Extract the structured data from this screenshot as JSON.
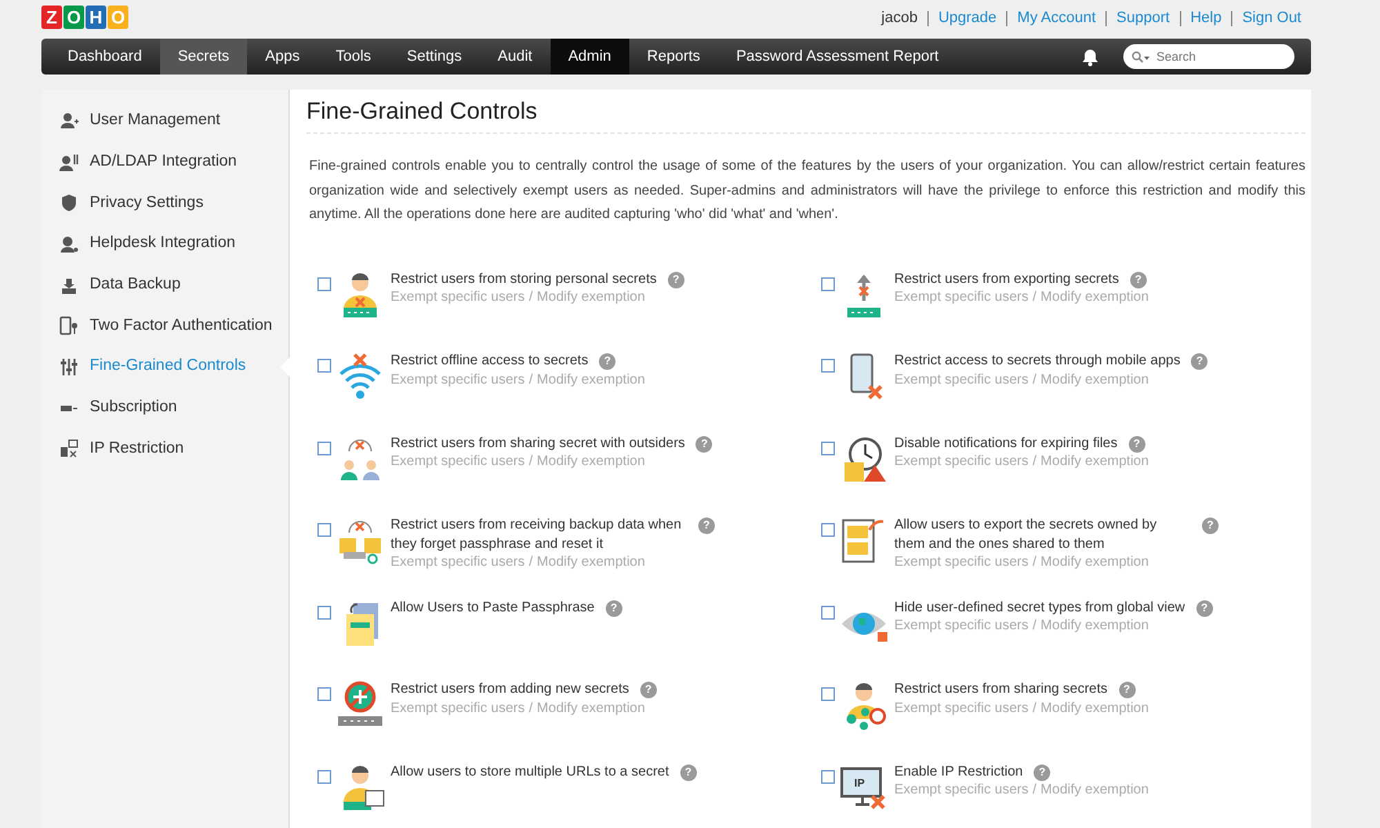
{
  "logo": [
    {
      "letter": "Z",
      "color": "#e42527"
    },
    {
      "letter": "O",
      "color": "#089949"
    },
    {
      "letter": "H",
      "color": "#226db4"
    },
    {
      "letter": "O",
      "color": "#f9b21d"
    }
  ],
  "user": "jacob",
  "header_links": [
    "Upgrade",
    "My Account",
    "Support",
    "Help",
    "Sign Out"
  ],
  "nav": [
    {
      "label": "Dashboard",
      "selected": false,
      "highlighted": false
    },
    {
      "label": "Secrets",
      "selected": false,
      "highlighted": true
    },
    {
      "label": "Apps",
      "selected": false,
      "highlighted": false
    },
    {
      "label": "Tools",
      "selected": false,
      "highlighted": false
    },
    {
      "label": "Settings",
      "selected": false,
      "highlighted": false
    },
    {
      "label": "Audit",
      "selected": false,
      "highlighted": false
    },
    {
      "label": "Admin",
      "selected": true,
      "highlighted": false
    },
    {
      "label": "Reports",
      "selected": false,
      "highlighted": false
    },
    {
      "label": "Password Assessment Report",
      "selected": false,
      "highlighted": false
    }
  ],
  "search": {
    "placeholder": "Search"
  },
  "sidebar": {
    "items": [
      {
        "label": "User Management",
        "selected": false
      },
      {
        "label": "AD/LDAP Integration",
        "selected": false
      },
      {
        "label": "Privacy Settings",
        "selected": false
      },
      {
        "label": "Helpdesk Integration",
        "selected": false
      },
      {
        "label": "Data Backup",
        "selected": false
      },
      {
        "label": "Two Factor Authentication",
        "selected": false
      },
      {
        "label": "Fine-Grained Controls",
        "selected": true
      },
      {
        "label": "Subscription",
        "selected": false
      },
      {
        "label": "IP Restriction",
        "selected": false
      }
    ]
  },
  "main": {
    "title": "Fine-Grained Controls",
    "description": "Fine-grained controls enable you to centrally control the usage of some of the features by the users of your organization. You can allow/restrict certain features organization wide and selectively exempt users as needed. Super-admins and administrators will have the privilege to enforce this restriction and modify this anytime. All the operations done here are audited capturing 'who' did 'what' and 'when'.",
    "controls": [
      {
        "label": "Restrict users from storing personal secrets",
        "checked": false,
        "help": "?",
        "links": [
          "Exempt specific users",
          "Modify exemption"
        ],
        "separator": "/"
      },
      {
        "label": "Restrict users from exporting secrets",
        "checked": false,
        "help": "?",
        "links": [
          "Exempt specific users",
          "Modify exemption"
        ],
        "separator": "/"
      },
      {
        "label": "Restrict offline access to secrets",
        "checked": false,
        "help": "?",
        "links": [
          "Exempt specific users",
          "Modify exemption"
        ],
        "separator": "/"
      },
      {
        "label": "Restrict access to secrets through mobile apps",
        "checked": false,
        "help": "?",
        "links": [
          "Exempt specific users",
          "Modify exemption"
        ],
        "separator": "/"
      },
      {
        "label": "Restrict users from sharing secret with outsiders",
        "checked": false,
        "help": "?",
        "links": [
          "Exempt specific users",
          "Modify exemption"
        ],
        "separator": "/"
      },
      {
        "label": "Disable notifications for expiring files",
        "checked": false,
        "help": "?",
        "links": [
          "Exempt specific users",
          "Modify exemption"
        ],
        "separator": "/"
      },
      {
        "label": "Restrict users from receiving backup data when they forget passphrase and reset it",
        "checked": false,
        "help": "?",
        "links": [
          "Exempt specific users",
          "Modify exemption"
        ],
        "separator": "/"
      },
      {
        "label": "Allow users to export the secrets owned by them and the ones shared to them",
        "checked": false,
        "help": "?",
        "links": [
          "Exempt specific users",
          "Modify exemption"
        ],
        "separator": "/"
      },
      {
        "label": "Allow Users to Paste Passphrase",
        "checked": false,
        "help": "?"
      },
      {
        "label": "Hide user-defined secret types from global view",
        "checked": false,
        "help": "?",
        "links": [
          "Exempt specific users",
          "Modify exemption"
        ],
        "separator": "/"
      },
      {
        "label": "Restrict users from adding new secrets",
        "checked": false,
        "help": "?",
        "links": [
          "Exempt specific users",
          "Modify exemption"
        ],
        "separator": "/"
      },
      {
        "label": "Restrict users from sharing secrets",
        "checked": false,
        "help": "?",
        "links": [
          "Exempt specific users",
          "Modify exemption"
        ],
        "separator": "/"
      },
      {
        "label": "Allow users to store multiple URLs to a secret",
        "checked": false,
        "help": "?"
      },
      {
        "label": "Enable IP Restriction",
        "checked": false,
        "help": "?",
        "icon_text": "IP",
        "links": [
          "Exempt specific users",
          "Modify exemption"
        ],
        "separator": "/"
      }
    ]
  }
}
